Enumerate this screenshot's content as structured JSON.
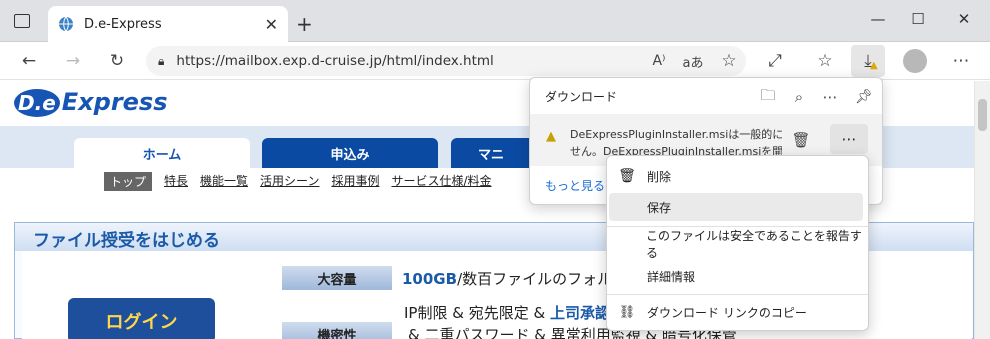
{
  "browser": {
    "tab_title": "D.e-Express",
    "tab_close": "✕",
    "new_tab": "+",
    "url": "https://mailbox.exp.d-cruise.jp/html/index.html"
  },
  "site": {
    "logo_de": "D.e",
    "logo_text": "Express",
    "nav_tabs": [
      "ホーム",
      "申込み",
      "マニ"
    ],
    "subnav": [
      "トップ",
      "特長",
      "機能一覧",
      "活用シーン",
      "採用事例",
      "サービス仕様/料金"
    ],
    "panel_title": "ファイル授受をはじめる",
    "login_label": "ログイン",
    "features": [
      {
        "label": "大容量",
        "text_strong": "100GB",
        "text": "/数百ファイルのフォル"
      },
      {
        "label": "機密性",
        "text": "IP制限 & 宛先限定 & ",
        "text_strong": "上司承認"
      },
      {
        "text": "& 二重パスワード & 異常利用監視 & 暗号化保管"
      }
    ]
  },
  "downloads": {
    "title": "ダウンロード",
    "item_line1": "DeExpressPluginInstaller.msiは一般的にダ",
    "item_line2": "せん。DeExpressPluginInstaller.msiを開く前",
    "more_link": "もっと見る",
    "more_button": "⋯"
  },
  "context_menu": [
    {
      "label": "削除",
      "icon": "trash-icon"
    },
    {
      "label": "保存",
      "icon": ""
    },
    {
      "label": "このファイルは安全であることを報告する",
      "icon": ""
    },
    {
      "label": "詳細情報",
      "icon": ""
    },
    {
      "label": "ダウンロード リンクのコピー",
      "icon": "link-icon"
    }
  ],
  "colors": {
    "brand": "#1755b4",
    "nav_active": "#ffffff",
    "nav": "#0b4aa2",
    "warning": "#c8a000"
  }
}
